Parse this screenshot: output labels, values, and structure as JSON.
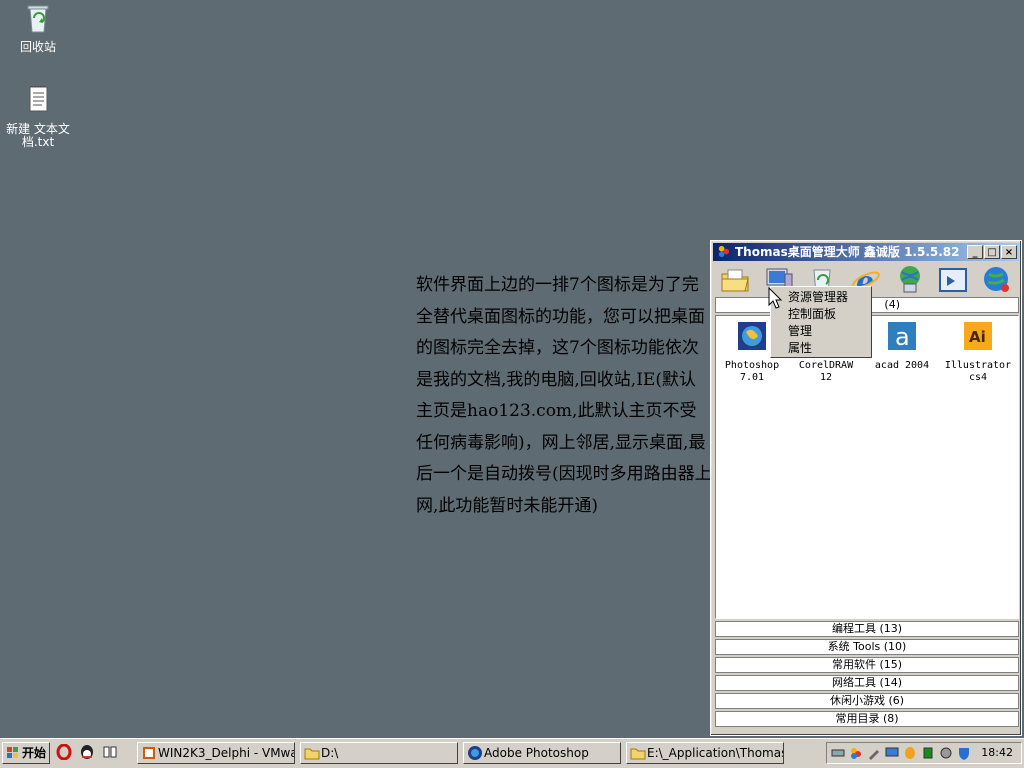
{
  "desktop": {
    "icons": [
      {
        "label": "回收站",
        "icon": "recycle-bin-icon"
      },
      {
        "label": "新建 文本文档.txt",
        "icon": "text-document-icon"
      }
    ],
    "note": "软件界面上边的一排7个图标是为了完全替代桌面图标的功能，您可以把桌面的图标完全去掉，这7个图标功能依次是我的文档,我的电脑,回收站,IE(默认主页是hao123.com,此默认主页不受任何病毒影响)，网上邻居,显示桌面,最后一个是自动拨号(因现时多用路由器上网,此功能暂时未能开通)"
  },
  "window": {
    "title": "Thomas桌面管理大师 鑫诚版 1.5.5.82",
    "buttons": {
      "minimize": "_",
      "maximize": "□",
      "close": "×"
    },
    "toolbar": [
      "my-documents-icon",
      "my-computer-icon",
      "recycle-bin-icon",
      "ie-icon",
      "network-neighborhood-icon",
      "show-desktop-icon",
      "auto-dial-icon"
    ],
    "group_count": "(4)",
    "apps": [
      {
        "label": "Photoshop 7.01",
        "icon": "photoshop-icon"
      },
      {
        "label": "CorelDRAW 12",
        "icon": "coreldraw-icon"
      },
      {
        "label": "acad 2004",
        "icon": "autocad-icon"
      },
      {
        "label": "Illustrator cs4",
        "icon": "illustrator-icon"
      }
    ],
    "categories": [
      "编程工具 (13)",
      "系统  Tools (10)",
      "常用软件 (15)",
      "网络工具 (14)",
      "休闲小游戏 (6)",
      "常用目录 (8)"
    ]
  },
  "context_menu": [
    "资源管理器",
    "控制面板",
    "管理",
    "属性"
  ],
  "taskbar": {
    "start_label": "开始",
    "quick_launch": [
      "opera-icon",
      "qq-icon",
      "book-icon"
    ],
    "tasks": [
      {
        "label": "WIN2K3_Delphi - VMwar...",
        "icon": "vmware-icon"
      },
      {
        "label": "D:\\",
        "icon": "folder-icon"
      },
      {
        "label": "Adobe Photoshop",
        "icon": "photoshop-icon"
      },
      {
        "label": "E:\\_Application\\ThomasS...",
        "icon": "folder-icon"
      }
    ],
    "clock": "18:42"
  },
  "colors": {
    "desktop": "#5f6b73",
    "titlebar_start": "#0a246a",
    "titlebar_end": "#a6caf0",
    "face": "#d4d0c8"
  }
}
